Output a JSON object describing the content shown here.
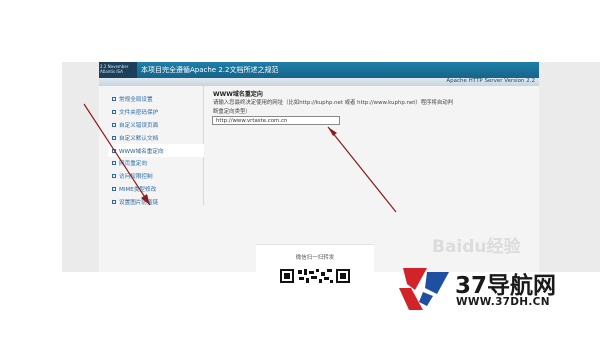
{
  "banner": {
    "logo_text": "2.2 November\nAtlantis ISA",
    "title": "本项目完全遵循Apache 2.2文档所述之规范",
    "version": "Apache HTTP Server Version 2.2"
  },
  "nav": {
    "items": [
      {
        "label": "常规全局设置",
        "active": false
      },
      {
        "label": "文件夹密码保护",
        "active": false
      },
      {
        "label": "自定义错误页面",
        "active": false
      },
      {
        "label": "自定义默认文档",
        "active": false
      },
      {
        "label": "WWW域名重定向",
        "active": true
      },
      {
        "label": "网页重定向",
        "active": false
      },
      {
        "label": "访问权限控制",
        "active": false
      },
      {
        "label": "MIME类型修改",
        "active": false
      },
      {
        "label": "设置图片防盗链",
        "active": false
      }
    ]
  },
  "main": {
    "title": "WWW域名重定向",
    "description": "请输入您最终决定使用的网址（比如http://kuphp.net 或者 http://www.kuphp.net）程序将自动判断重定向类型）",
    "url_value": "http://www.vrtaste.com.cn"
  },
  "qr": {
    "label": "微信扫一扫转发"
  },
  "watermark": {
    "text": "Baidu经验"
  },
  "brand": {
    "name": "37导航网",
    "url": "WWW.37DH.CN",
    "accent_colors": {
      "red": "#d2232a",
      "blue": "#1f4fa3",
      "arrow": "#8a1c1c"
    }
  }
}
